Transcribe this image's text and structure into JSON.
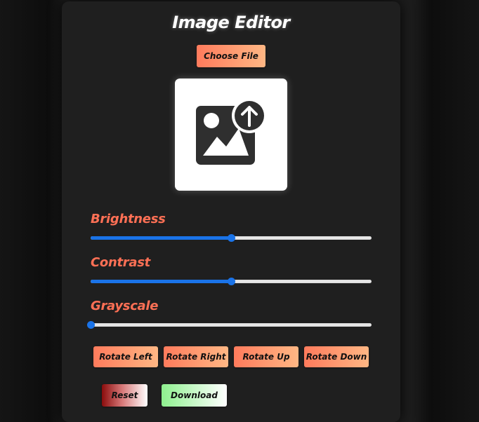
{
  "app": {
    "title": "Image Editor"
  },
  "file": {
    "choose_label": "Choose File"
  },
  "preview": {
    "icon": "image-upload-icon"
  },
  "adjustments": {
    "brightness": {
      "label": "Brightness",
      "value": 0.5
    },
    "contrast": {
      "label": "Contrast",
      "value": 0.5
    },
    "grayscale": {
      "label": "Grayscale",
      "value": 0
    }
  },
  "rotate": {
    "left": "Rotate Left",
    "right": "Rotate Right",
    "up": "Rotate Up",
    "down": "Rotate Down"
  },
  "actions": {
    "reset": "Reset",
    "download": "Download"
  },
  "colors": {
    "accent": "#ff7055",
    "slider": "#1a73e8"
  }
}
